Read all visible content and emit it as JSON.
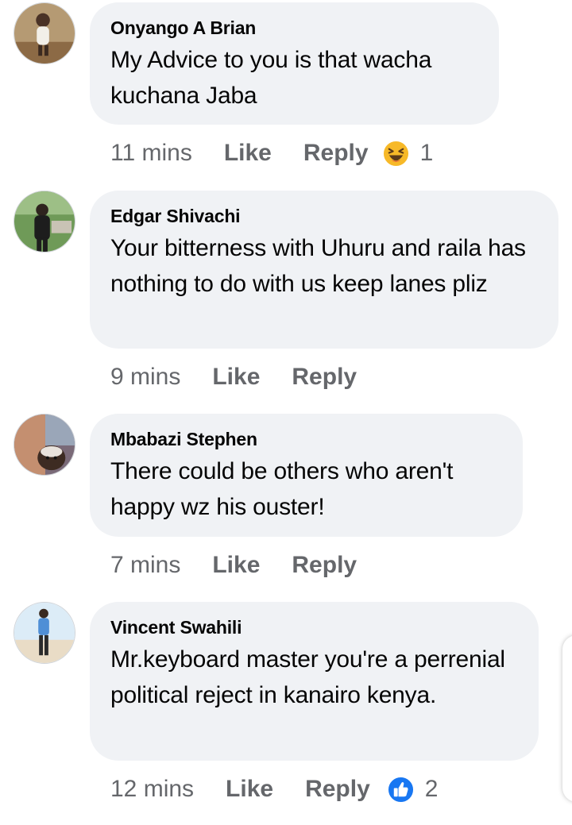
{
  "comments": [
    {
      "author": "Onyango A Brian",
      "text": "My Advice to you is that wacha kuchana Jaba",
      "time": "11 mins",
      "like_label": "Like",
      "reply_label": "Reply",
      "reaction": {
        "icon": "haha-emoji-icon",
        "count": "1"
      }
    },
    {
      "author": "Edgar Shivachi",
      "text": "Your bitterness with Uhuru and raila has nothing to do with us keep lanes pliz",
      "time": "9 mins",
      "like_label": "Like",
      "reply_label": "Reply"
    },
    {
      "author": "Mbabazi Stephen",
      "text": "There could be others who aren't happy wz his ouster!",
      "time": "7 mins",
      "like_label": "Like",
      "reply_label": "Reply"
    },
    {
      "author": "Vincent Swahili",
      "text": "Mr.keyboard master you're a perrenial  political reject in kanairo kenya.",
      "time": "12 mins",
      "like_label": "Like",
      "reply_label": "Reply",
      "reaction": {
        "icon": "like-thumb-icon",
        "count": "2"
      }
    }
  ],
  "colors": {
    "bubble_bg": "#f0f2f5",
    "meta_text": "#65676b",
    "like_blue": "#1877f2",
    "haha_yellow": "#f7b928"
  }
}
